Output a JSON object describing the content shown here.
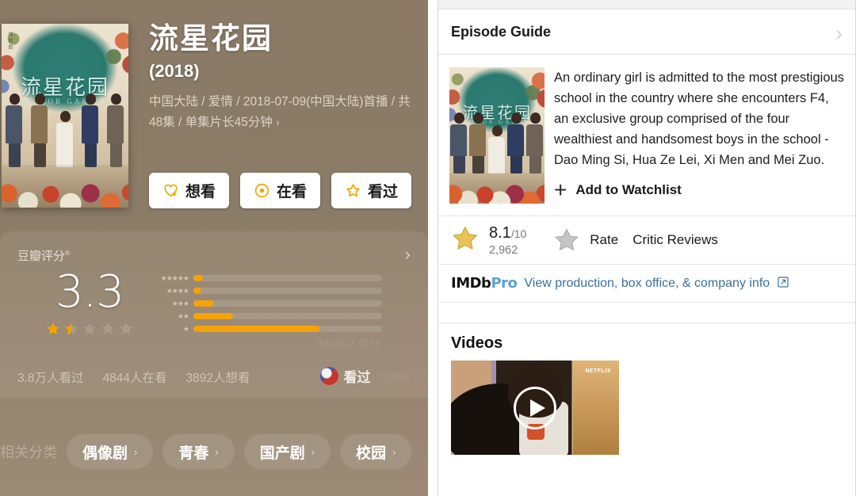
{
  "douban": {
    "title": "流星花园",
    "year": "(2018)",
    "meta_line": "中国大陆 / 爱情 / 2018-07-09(中国大陆)首播 / 共48集 / 单集片长45分钟",
    "meta_chevron": "›",
    "poster": {
      "cn_title": "流星花园",
      "en_title": "METEOR GARDEN",
      "vertical_text": "偶像剧"
    },
    "actions": [
      {
        "icon": "heart-plus-icon",
        "label": "想看"
      },
      {
        "icon": "dot-circle-icon",
        "label": "在看"
      },
      {
        "icon": "star-outline-icon",
        "label": "看过"
      }
    ],
    "rating_card": {
      "label": "豆瓣评分",
      "label_sup": "®",
      "chevron": "›",
      "score": "3.3",
      "stars_filled": 1.5,
      "stars_total": 5,
      "vote_count_text": "38550人评分",
      "distribution": [
        {
          "stars": "★★★★★",
          "pct": 5
        },
        {
          "stars": "★★★★",
          "pct": 4
        },
        {
          "stars": "★★★",
          "pct": 11
        },
        {
          "stars": "★★",
          "pct": 21
        },
        {
          "stars": "★",
          "pct": 67
        }
      ]
    },
    "stats": [
      "3.8万人看过",
      "4844人在看",
      "3892人想看"
    ],
    "seen": {
      "label": "看过",
      "time_ago": "1分钟前"
    },
    "tags_label": "相关分类",
    "tags": [
      "偶像剧",
      "青春",
      "国产剧",
      "校园"
    ],
    "tag_chevron": "›"
  },
  "imdb": {
    "episode_guide": {
      "title": "Episode Guide",
      "chevron": "›"
    },
    "summary": "An ordinary girl is admitted to the most prestigious school in the country where she encounters F4, an exclusive group comprised of the four wealthiest and handsomest boys in the school - Dao Ming Si, Hua Ze Lei, Xi Men and Mei Zuo.",
    "watchlist": {
      "plus": "+",
      "label": "Add to Watchlist"
    },
    "rating": {
      "score": "8.1",
      "denominator": "/10",
      "votes": "2,962",
      "rate_label": "Rate",
      "critic_label": "Critic Reviews"
    },
    "pro": {
      "logo_dark": "IMDb",
      "logo_blue": "Pro",
      "link_text": "View production, box office, & company info",
      "external_icon": "↗"
    },
    "videos": {
      "heading": "Videos",
      "thumb_badge": "NETFLIX",
      "play_icon": "play-icon"
    }
  },
  "colors": {
    "douban_bg": "#8a7a66",
    "accent_orange": "#f6a208",
    "imdb_gold": "#e8c252",
    "pro_blue": "#5aa3d0",
    "link_blue": "#3a6f9a"
  }
}
